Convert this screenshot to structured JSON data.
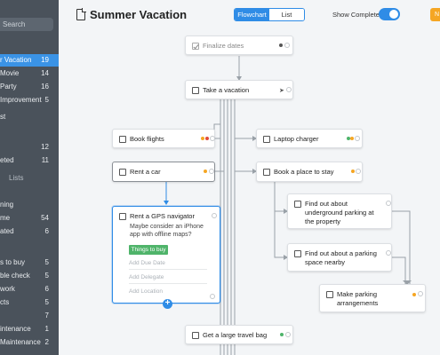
{
  "sidebar": {
    "search_placeholder": "Search",
    "items": [
      {
        "label": "r Vacation",
        "count": "19",
        "active": true
      },
      {
        "label": "Movie",
        "count": "14"
      },
      {
        "label": "Party",
        "count": "16"
      },
      {
        "label": "Improvement",
        "count": "5"
      },
      {
        "label": "st",
        "count": ""
      },
      {
        "label": "",
        "count": "12"
      },
      {
        "label": "eted",
        "count": "11"
      },
      {
        "label": "Lists",
        "count": "",
        "dim": true
      },
      {
        "label": "ning",
        "count": ""
      },
      {
        "label": "me",
        "count": "54"
      },
      {
        "label": "ated",
        "count": "6"
      },
      {
        "label": "s to buy",
        "count": "5"
      },
      {
        "label": "ble check",
        "count": "5"
      },
      {
        "label": "work",
        "count": "6"
      },
      {
        "label": "cts",
        "count": "5"
      },
      {
        "label": "",
        "count": "7"
      },
      {
        "label": "intenance",
        "count": "1"
      },
      {
        "label": "Maintenance",
        "count": "2"
      }
    ]
  },
  "toolbar": {
    "title": "Summer Vacation",
    "view_flowchart": "Flowchart",
    "view_list": "List",
    "show_completed_label": "Show Completed",
    "show_completed": true,
    "new_label": "N"
  },
  "nodes": {
    "finalize": {
      "label": "Finalize dates",
      "completed": true
    },
    "vacation": {
      "label": "Take a vacation"
    },
    "flights": {
      "label": "Book flights"
    },
    "laptop": {
      "label": "Laptop charger"
    },
    "car": {
      "label": "Rent a car"
    },
    "stay": {
      "label": "Book a place to stay"
    },
    "gps": {
      "label": "Rent a GPS navigator",
      "note": "Maybe consider an iPhone app with offline maps?",
      "tag": "Things to buy",
      "due": "Add Due Date",
      "delegate": "Add Delegate",
      "location": "Add Location"
    },
    "parking_underground": {
      "label": "Find out about underground parking at the property"
    },
    "parking_nearby": {
      "label": "Find out about a parking space nearby"
    },
    "make_parking": {
      "label": "Make parking arrangements"
    },
    "travel_bag": {
      "label": "Get a large travel bag"
    }
  },
  "colors": {
    "accent": "#2f8ce6",
    "orange": "#f5a623",
    "green": "#4fb46a",
    "red": "#e14b3b"
  }
}
